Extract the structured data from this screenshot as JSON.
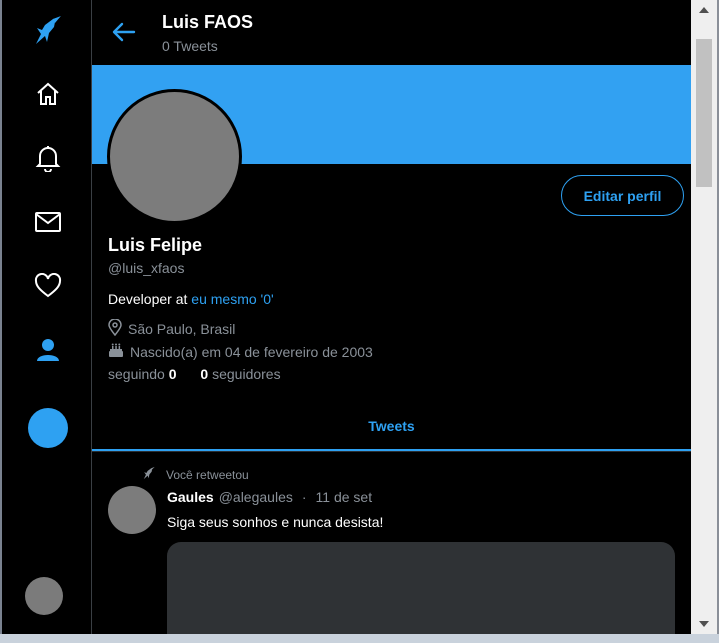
{
  "header": {
    "title": "Luis FAOS",
    "subtitle": "0 Tweets"
  },
  "profile": {
    "name": "Luis Felipe",
    "handle": "@luis_xfaos",
    "bio_prefix": "Developer at ",
    "bio_link": "eu mesmo '0'",
    "location": "São Paulo, Brasil",
    "birth": "Nascido(a) em 04 de fevereiro de 2003",
    "following_label": "seguindo",
    "following_count": "0",
    "followers_count": "0",
    "followers_label": "seguidores",
    "edit_label": "Editar perfil"
  },
  "tabs": {
    "tweets": "Tweets"
  },
  "tweet": {
    "retweet_label": "Você retweetou",
    "author": "Gaules",
    "handle": "@alegaules",
    "separator": "·",
    "date": "11 de set",
    "text": "Siga seus sonhos e nunca desista!"
  },
  "colors": {
    "accent": "#32a1f2",
    "muted": "#8a9199",
    "background": "#000000"
  },
  "icons": [
    "bird-icon",
    "home-icon",
    "bell-icon",
    "mail-icon",
    "heart-icon",
    "profile-icon",
    "arrow-left-icon",
    "location-icon",
    "cake-icon",
    "retweet-icon"
  ]
}
